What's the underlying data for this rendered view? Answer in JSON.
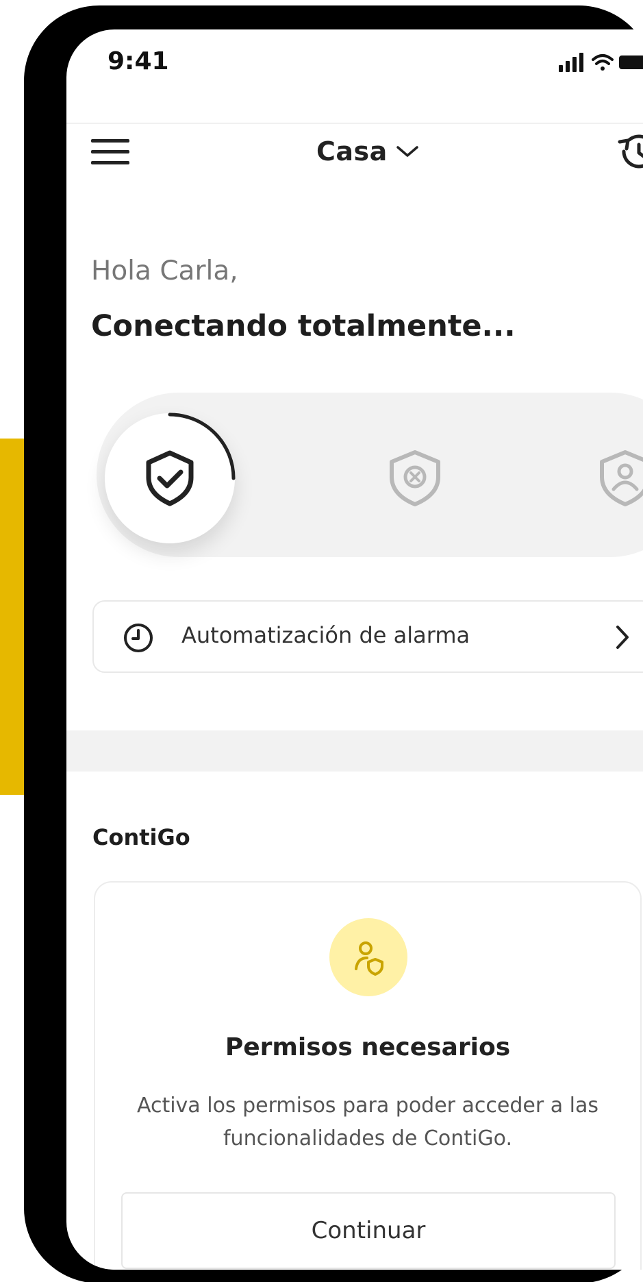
{
  "status_bar": {
    "time": "9:41",
    "icons": [
      "signal-icon",
      "wifi-icon",
      "battery-icon"
    ]
  },
  "nav": {
    "menu_icon": "hamburger-menu-icon",
    "location_label": "Casa",
    "location_chevron_icon": "chevron-down-icon",
    "history_icon": "history-icon",
    "has_notification": true
  },
  "greeting": "Hola Carla,",
  "status_heading": "Conectando totalmente...",
  "alarm_modes": [
    {
      "icon": "shield-check-icon",
      "state": "active-connecting"
    },
    {
      "icon": "shield-x-icon",
      "state": "inactive"
    },
    {
      "icon": "shield-person-icon",
      "state": "inactive"
    }
  ],
  "automation": {
    "icon": "clock-icon",
    "label": "Automatización de alarma",
    "chevron_icon": "chevron-right-icon"
  },
  "contigo": {
    "section_title": "ContiGo",
    "card": {
      "icon": "person-shield-icon",
      "title": "Permisos necesarios",
      "description": "Activa los permisos para poder acceder a las funcionalidades de ContiGo.",
      "button_label": "Continuar"
    }
  },
  "colors": {
    "brand_yellow": "#E6B800",
    "icon_bg_yellow": "#FFF1A6",
    "notification_red": "#E8372C",
    "text_dark": "#1e1e1e"
  }
}
